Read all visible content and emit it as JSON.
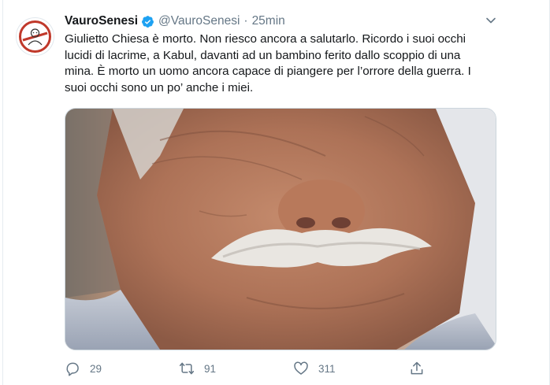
{
  "tweet": {
    "display_name": "VauroSenesi",
    "handle": "@VauroSenesi",
    "separator": "·",
    "time": "25min",
    "text_lines": [
      "Giulietto Chiesa è morto. Non riesco ancora a salutarlo. Ricordo i suoi occhi",
      "lucidi di lacrime, a Kabul, davanti ad un bambino ferito dallo scoppio di una",
      "mina. È morto un uomo ancora capace di piangere per l’orrore della guerra. I",
      "suoi occhi sono un po’ anche i miei."
    ],
    "verified": true
  },
  "actions": {
    "reply": {
      "icon": "reply-icon",
      "count": "29"
    },
    "retweet": {
      "icon": "retweet-icon",
      "count": "91"
    },
    "like": {
      "icon": "heart-icon",
      "count": "311"
    },
    "share": {
      "icon": "share-icon"
    }
  },
  "colors": {
    "text": "#14171a",
    "secondary": "#657786",
    "verified": "#1da1f2",
    "avatar_accent": "#c0392b"
  }
}
